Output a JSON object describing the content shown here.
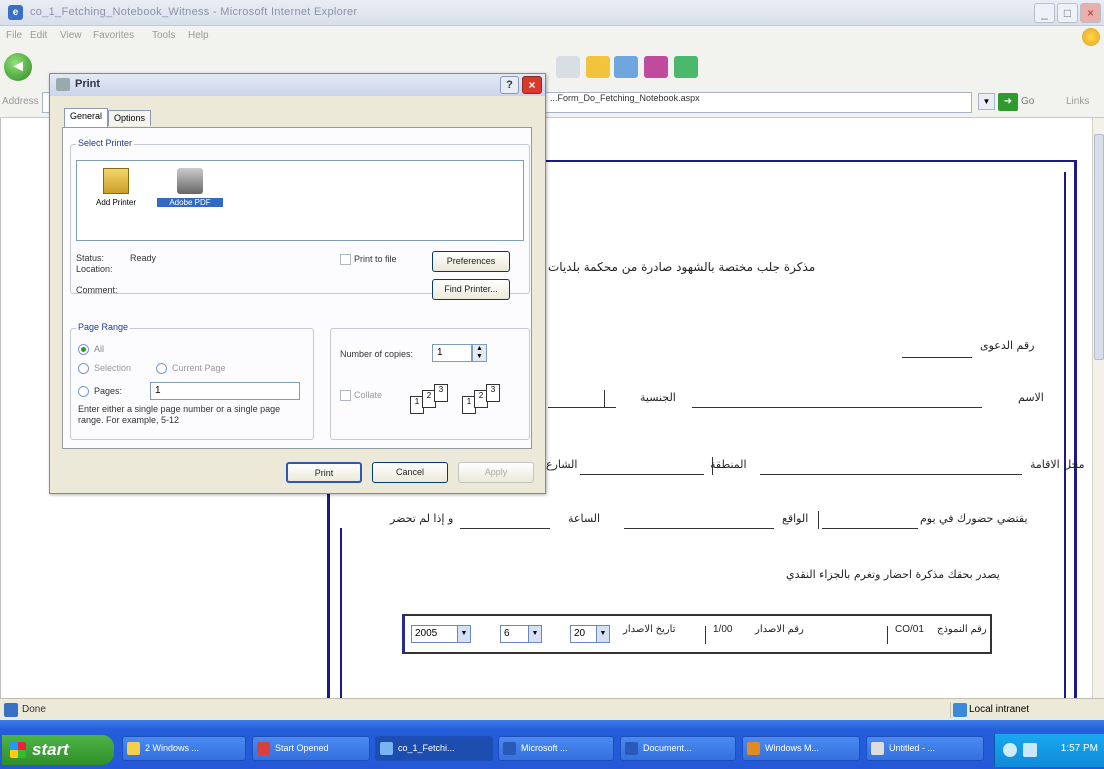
{
  "ie": {
    "title": "co_1_Fetching_Notebook_Witness - Microsoft Internet Explorer",
    "menu": [
      "File",
      "Edit",
      "View",
      "Favorites",
      "Tools",
      "Help"
    ],
    "address_label": "Address",
    "address_value": "...Form_Do_Fetching_Notebook.aspx",
    "go_label": "Go",
    "links_label": "Links"
  },
  "dialog": {
    "title": "Print",
    "tabs": [
      "General",
      "Options"
    ],
    "select_printer_label": "Select Printer",
    "printers": [
      {
        "name": "Add Printer",
        "icon": "add-printer-icon"
      },
      {
        "name": "Adobe PDF",
        "icon": "printer-icon",
        "selected": true
      }
    ],
    "status_label": "Status:",
    "status_value": "Ready",
    "location_label": "Location:",
    "comment_label": "Comment:",
    "print_to_file_label": "Print to file",
    "preferences_label": "Preferences",
    "find_printer_label": "Find Printer...",
    "page_range": {
      "label": "Page Range",
      "all_label": "All",
      "selection_label": "Selection",
      "current_page_label": "Current Page",
      "pages_label": "Pages:",
      "pages_value": "1",
      "hint": "Enter either a single page number or a single page range. For example, 5-12"
    },
    "copies": {
      "number_label": "Number of copies:",
      "number_value": "1",
      "collate_label": "Collate"
    },
    "buttons": {
      "print": "Print",
      "cancel": "Cancel",
      "apply": "Apply"
    }
  },
  "page": {
    "heading": "مذكرة جلب مختصة بالشهود صادرة من محكمة بلديات",
    "case_no_label": "رقم الدعوى",
    "name_label": "الاسم",
    "nationality_label": "الجنسية",
    "residence_label": "محل الاقامة",
    "district_label": "المنطقة",
    "street_label": "الشارع",
    "attend_label": "يقتضي حضورك في يوم",
    "date_label": "الواقع",
    "hour_label": "الساعة",
    "absent_label": "و إذا لم تحضر",
    "footer_label": "يصدر بحقك مذكرة احضار وتغرم بالجزاء النقدي",
    "form_no_label": "رقم النموذج",
    "form_no_value": "CO/01",
    "issue_no_label": "رقم الاصدار",
    "issue_no_value": "1/00",
    "issue_date_label": "تاريخ الاصدار",
    "day_value": "20",
    "month_value": "6",
    "year_value": "2005"
  },
  "status_bar": {
    "text": "Done",
    "zone": "Local intranet"
  },
  "taskbar": {
    "start_label": "start",
    "tasks": [
      {
        "label": "2 Windows ..."
      },
      {
        "label": "Start Opened"
      },
      {
        "label": "co_1_Fetchi...",
        "active": true
      },
      {
        "label": "Microsoft ..."
      },
      {
        "label": "Document..."
      },
      {
        "label": "Windows M..."
      },
      {
        "label": "Untitled - ..."
      }
    ],
    "clock": "1:57 PM"
  }
}
